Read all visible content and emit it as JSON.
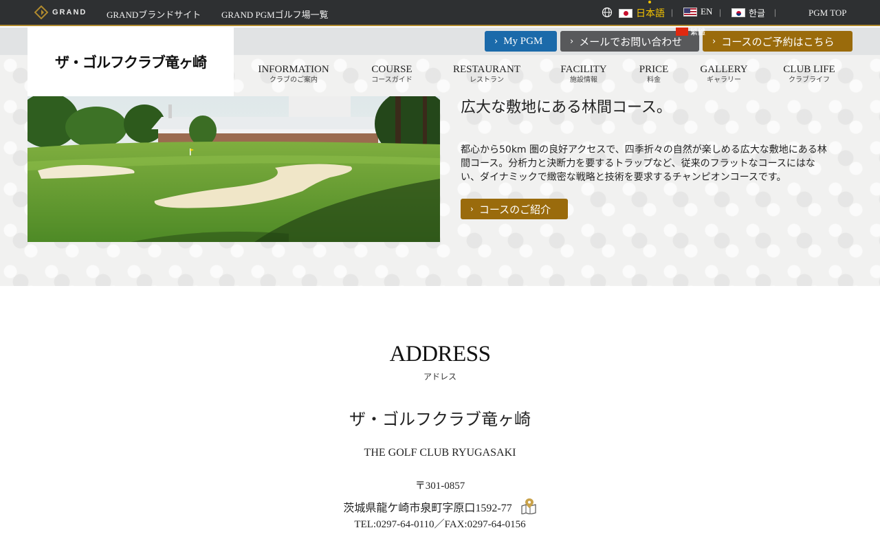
{
  "topbar": {
    "logo_text": "GRAND",
    "links": [
      "GRANDブランドサイト",
      "GRAND PGMゴルフ場一覧"
    ],
    "languages": {
      "ja": "日本語",
      "en": "EN",
      "ko": "한글",
      "zh": "繁體"
    },
    "pgm_top": "PGM TOP"
  },
  "header": {
    "site_name": "ザ・ゴルフクラブ竜ヶ崎",
    "buttons": {
      "mypgm": "My PGM",
      "mail": "メールでお問い合わせ",
      "reserve": "コースのご予約はこちら"
    },
    "nav": [
      {
        "en": "INFORMATION",
        "ja": "クラブのご案内"
      },
      {
        "en": "COURSE",
        "ja": "コースガイド"
      },
      {
        "en": "RESTAURANT",
        "ja": "レストラン"
      },
      {
        "en": "FACILITY",
        "ja": "施設情報"
      },
      {
        "en": "PRICE",
        "ja": "料金"
      },
      {
        "en": "GALLERY",
        "ja": "ギャラリー"
      },
      {
        "en": "CLUB LIFE",
        "ja": "クラブライフ"
      }
    ]
  },
  "course": {
    "title": "広大な敷地にある林間コース。",
    "description": "都心から50km 圏の良好アクセスで、四季折々の自然が楽しめる広大な敷地にある林間コース。分析力と決断力を要するトラップなど、従来のフラットなコースにはない、ダイナミックで緻密な戦略と技術を要求するチャンピオンコースです。",
    "button": "コースのご紹介"
  },
  "address": {
    "heading": "ADDRESS",
    "heading_ja": "アドレス",
    "club_ja": "ザ・ゴルフクラブ竜ヶ崎",
    "club_en": "THE GOLF CLUB RYUGASAKI",
    "postal": "〒301-0857",
    "address": "茨城県龍ケ崎市泉町字原口1592-77",
    "tel": "TEL:0297-64-0110／FAX:0297-64-0156"
  },
  "colors": {
    "topbar_bg": "#2e3032",
    "accent_gold": "#9a6b0c",
    "mypgm_blue": "#1b6aaa",
    "mail_gray": "#58595b"
  }
}
